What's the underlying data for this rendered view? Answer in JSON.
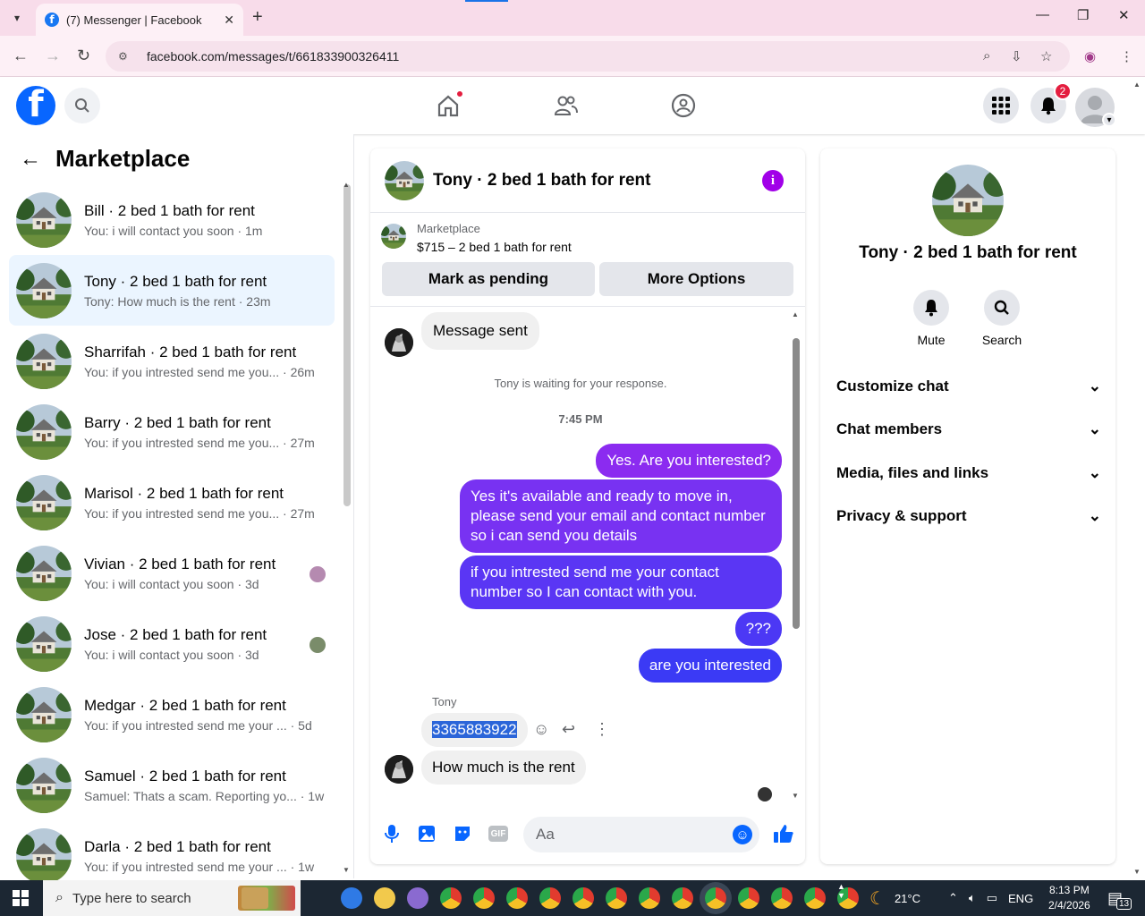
{
  "browser": {
    "tab_title": "(7) Messenger | Facebook",
    "url": "facebook.com/messages/t/661833900326411"
  },
  "header": {
    "notif_count": "2"
  },
  "sidebar": {
    "title": "Marketplace",
    "items": [
      {
        "name": "Bill · 2 bed 1 bath for rent",
        "sub": "You: i will contact you soon · 1m"
      },
      {
        "name": "Tony · 2 bed 1 bath for rent",
        "sub": "Tony: How much is the rent · 23m"
      },
      {
        "name": "Sharrifah · 2 bed 1 bath for rent",
        "sub": "You: if you intrested send me you... · 26m"
      },
      {
        "name": "Barry · 2 bed 1 bath for rent",
        "sub": "You: if you intrested send me you... · 27m"
      },
      {
        "name": "Marisol · 2 bed 1 bath for rent",
        "sub": "You: if you intrested send me you... · 27m"
      },
      {
        "name": "Vivian · 2 bed 1 bath for rent",
        "sub": "You: i will contact you soon · 3d"
      },
      {
        "name": "Jose · 2 bed 1 bath for rent",
        "sub": "You: i will contact you soon · 3d"
      },
      {
        "name": "Medgar · 2 bed 1 bath for rent",
        "sub": "You: if you intrested send me your ... · 5d"
      },
      {
        "name": "Samuel · 2 bed 1 bath for rent",
        "sub": "Samuel: Thats a scam. Reporting yo... · 1w"
      },
      {
        "name": "Darla · 2 bed 1 bath for rent",
        "sub": "You: if you intrested send me your ... · 1w"
      }
    ]
  },
  "chat": {
    "title": "Tony · 2 bed 1 bath for rent",
    "listing_source": "Marketplace",
    "listing_price": "$715 – 2 bed 1 bath for rent",
    "mark_pending": "Mark as pending",
    "more_options": "More Options",
    "msg_sent": "Message sent",
    "waiting": "Tony is waiting for your response.",
    "time": "7:45 PM",
    "out1": "Yes. Are you interested?",
    "out2": "Yes it's available and ready to move in, please send your email and contact number so i can send you details",
    "out3": "if you intrested send me your contact number so I can contact with you.",
    "out4": "???",
    "out5": "are you interested",
    "sender": "Tony",
    "in1": "3365883922",
    "in2": "How much is the rent",
    "placeholder": "Aa"
  },
  "details": {
    "name": "Tony · 2 bed 1 bath for rent",
    "mute": "Mute",
    "search": "Search",
    "sections": [
      "Customize chat",
      "Chat members",
      "Media, files and links",
      "Privacy & support"
    ]
  },
  "taskbar": {
    "search": "Type here to search",
    "temp": "21°C",
    "lang": "ENG",
    "time": "8:13 PM",
    "date": "2/4/2026",
    "notif": "13"
  }
}
